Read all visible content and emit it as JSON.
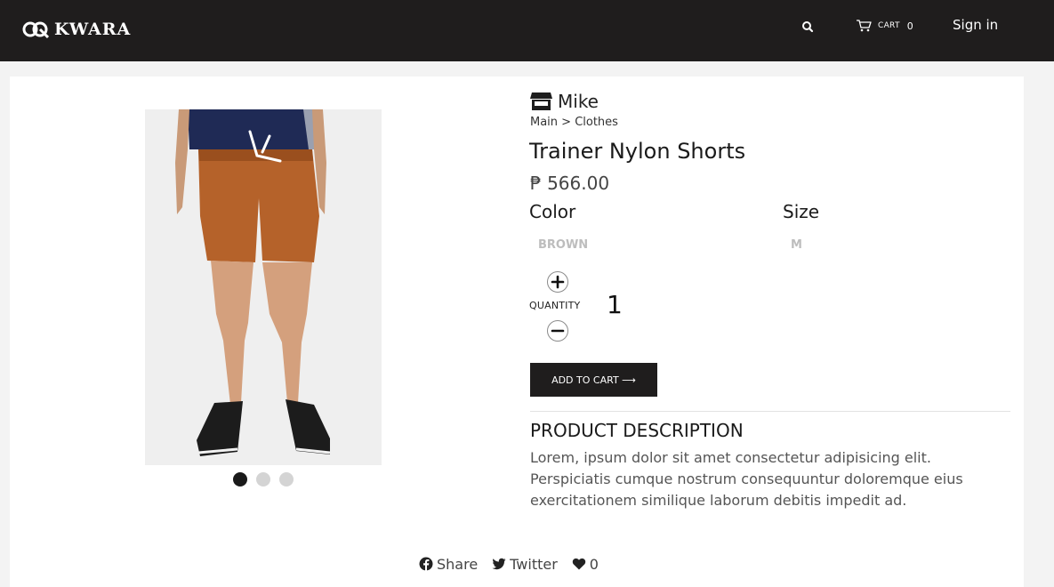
{
  "header": {
    "brand": "KWARA",
    "cart_label": "CART",
    "cart_count": "0",
    "signin_label": "Sign in"
  },
  "product": {
    "store_name": "Mike",
    "breadcrumb": "Main > Clothes",
    "title": "Trainer Nylon Shorts",
    "price": "₱ 566.00",
    "color_heading": "Color",
    "color_value": "BROWN",
    "size_heading": "Size",
    "size_value": "M",
    "quantity_label": "QUANTITY",
    "quantity_value": "1",
    "add_to_cart_label": "ADD TO CART ⟶",
    "description_heading": "PRODUCT DESCRIPTION",
    "description": "Lorem, ipsum dolor sit amet consectetur adipisicing elit. Perspiciatis cumque nostrum consequuntur doloremque eius exercitationem similique laborum debitis impedit ad.",
    "image_count": 3,
    "active_image": 1
  },
  "social": {
    "share_label": "Share",
    "twitter_label": "Twitter",
    "likes_count": "0"
  },
  "colors": {
    "header_bg": "#1f1d1d",
    "page_bg": "#f3f3f3",
    "shorts": "#b5622a",
    "shirt": "#1f2a55"
  }
}
